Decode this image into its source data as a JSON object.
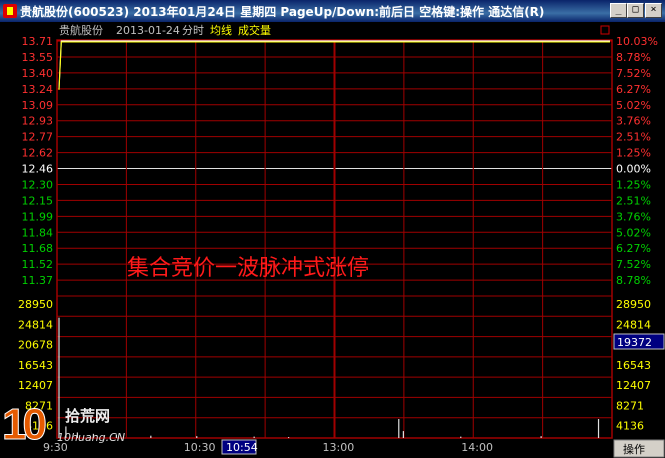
{
  "window": {
    "title": "贵航股份(600523) 2013年01月24日 星期四 PageUp/Down:前后日 空格键:操作 通达信(R)",
    "controls": {
      "minimize": "_",
      "maximize": "□",
      "close": "×"
    }
  },
  "header": {
    "stock_name": "贵航股份",
    "date": "2013-01-24",
    "mode": "分时",
    "avg_line": "均线",
    "volume": "成交量",
    "corner_icon": "restore-icon"
  },
  "annotation": "集合竞价一波脉冲式涨停",
  "colors": {
    "up": "#ff3030",
    "down": "#00d000",
    "neutral": "#ffffff",
    "grid": "#a00000",
    "price_line": "#ffffff",
    "avg_line": "#ffff00",
    "volume_label": "#ffff00"
  },
  "price_axis": {
    "labels": [
      "13.71",
      "13.55",
      "13.40",
      "13.24",
      "13.09",
      "12.93",
      "12.77",
      "12.62",
      "12.46",
      "12.30",
      "12.15",
      "11.99",
      "11.84",
      "11.68",
      "11.52",
      "11.37"
    ],
    "base_index": 8
  },
  "pct_axis": {
    "labels": [
      "10.03%",
      "8.78%",
      "7.52%",
      "6.27%",
      "5.02%",
      "3.76%",
      "2.51%",
      "1.25%",
      "0.00%",
      "1.25%",
      "2.51%",
      "3.76%",
      "5.02%",
      "6.27%",
      "7.52%",
      "8.78%"
    ]
  },
  "volume_axis": {
    "labels": [
      "28950",
      "24814",
      "20678",
      "16543",
      "12407",
      "8271",
      "4136"
    ],
    "current_value": "19372"
  },
  "time_axis": {
    "labels": [
      "9:30",
      "10:30",
      "13:00",
      "14:00"
    ],
    "cursor_time": "10:54"
  },
  "bottom_button": "操作",
  "watermark": {
    "number": "10",
    "name": "拾荒网",
    "url": "10huang.CN"
  },
  "chart_data": {
    "type": "line",
    "price_series": [
      {
        "minute": 0,
        "price": 13.24
      },
      {
        "minute": 1,
        "price": 13.71
      },
      {
        "minute": 240,
        "price": 13.71
      }
    ],
    "price_range": [
      11.37,
      13.71
    ],
    "base_price": 12.46,
    "volume_series": [
      {
        "minute": 0,
        "volume": 26000
      },
      {
        "minute": 3,
        "volume": 2500
      },
      {
        "minute": 8,
        "volume": 1200
      },
      {
        "minute": 15,
        "volume": 900
      },
      {
        "minute": 25,
        "volume": 700
      },
      {
        "minute": 40,
        "volume": 500
      },
      {
        "minute": 60,
        "volume": 400
      },
      {
        "minute": 85,
        "volume": 300
      },
      {
        "minute": 100,
        "volume": 200
      },
      {
        "minute": 148,
        "volume": 4100
      },
      {
        "minute": 150,
        "volume": 1500
      },
      {
        "minute": 175,
        "volume": 300
      },
      {
        "minute": 210,
        "volume": 400
      },
      {
        "minute": 235,
        "volume": 4100
      }
    ],
    "volume_range": [
      0,
      28950
    ]
  }
}
